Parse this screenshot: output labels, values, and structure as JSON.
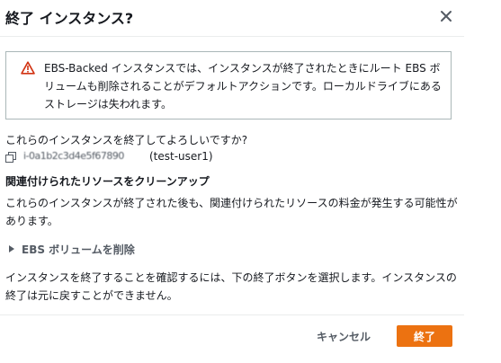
{
  "dialog": {
    "title": "終了 インスタンス?",
    "close_icon": "close-icon"
  },
  "warning": {
    "icon": "warning-triangle-icon",
    "color": "#d13212",
    "text": "EBS-Backed インスタンスでは、インスタンスが終了されたときにルート EBS ボリュームも削除されることがデフォルトアクションです。ローカルドライブにあるストレージは失われます。"
  },
  "confirm_question": "これらのインスタンスを終了してよろしいですか?",
  "instance": {
    "copy_icon": "copy-icon",
    "id": "i-0a1b2c3d4e5f67890",
    "name": "(test-user1)"
  },
  "related_resources": {
    "heading": "関連付けられたリソースをクリーンアップ",
    "body": "これらのインスタンスが終了された後も、関連付けられたリソースの料金が発生する可能性があります。"
  },
  "ebs_expander": {
    "icon": "caret-right-icon",
    "label": "EBS ボリュームを削除"
  },
  "final_confirm_text": "インスタンスを終了することを確認するには、下の終了ボタンを選択します。インスタンスの終了は元に戻すことができません。",
  "footer": {
    "cancel_label": "キャンセル",
    "terminate_label": "終了",
    "accent_color": "#ec7211"
  }
}
